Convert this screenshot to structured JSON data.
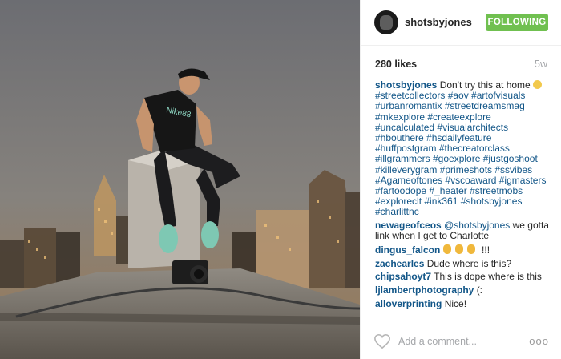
{
  "post": {
    "username": "shotsbyjones",
    "follow_label": "FOLLOWING",
    "likes": "280 likes",
    "age": "5w",
    "caption": {
      "user": "shotsbyjones",
      "text": "Don't try this at home ",
      "hashtags": "#streetcollectors #aov #artofvisuals #urbanromantix #streetdreamsmag #mkexplore #createexplore #uncalculated #visualarchitects #hbouthere #hsdailyfeature #huffpostgram #thecreatorclass #illgrammers #goexplore #justgoshoot #killeverygram #primeshots #ssvibes #Agameoftones #vscoaward #igmasters #fartoodope #_heater #streetmobs #exploreclt #ink361 #shotsbyjones #charlittnc"
    },
    "comments": [
      {
        "user": "newageofceos",
        "mention": "@shotsbyjones",
        "text": " we gotta link when I get to Charlotte"
      },
      {
        "user": "dingus_falcon",
        "text": " !!!"
      },
      {
        "user": "zachearles",
        "text": "Dude where is this?"
      },
      {
        "user": "chipsahoyt7",
        "text": "This is dope where is this"
      },
      {
        "user": "ljlambertphotography",
        "text": "(:"
      },
      {
        "user": "alloverprinting",
        "text": "Nice!"
      }
    ],
    "add_comment_placeholder": "Add a comment...",
    "more_label": "ooo",
    "photo_text": "Nike88",
    "icons": {
      "like": "heart-icon",
      "emoji_smile": "smile-emoji-icon",
      "emoji_clap": "clap-emoji-icon",
      "more": "more-options-icon"
    },
    "colors": {
      "follow_bg": "#70c050",
      "link": "#125688",
      "muted": "#a5a7aa"
    }
  }
}
